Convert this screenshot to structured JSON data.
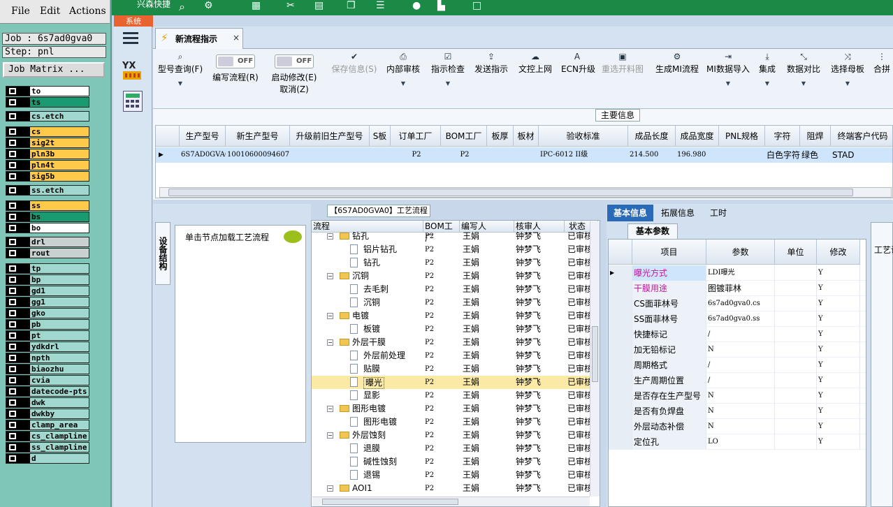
{
  "menu": {
    "file": "File",
    "edit": "Edit",
    "actions": "Actions"
  },
  "job": {
    "job_label": "Job : 6s7ad0gva0",
    "step_label": "Step: pnl",
    "matrix_button": "Job Matrix ..."
  },
  "layers": [
    {
      "name": "to",
      "color": "#ffffff"
    },
    {
      "name": "ts",
      "color": "#1a9a70"
    },
    {
      "name": "cs.etch",
      "color": "#a0d8cf"
    },
    {
      "name": "cs",
      "color": "#ffc94a"
    },
    {
      "name": "sig2t",
      "color": "#ffc94a"
    },
    {
      "name": "pln3b",
      "color": "#ffc94a"
    },
    {
      "name": "pln4t",
      "color": "#ffc94a"
    },
    {
      "name": "sig5b",
      "color": "#ffc94a"
    },
    {
      "name": "ss.etch",
      "color": "#a0d8cf"
    },
    {
      "name": "ss",
      "color": "#ffc94a"
    },
    {
      "name": "bs",
      "color": "#1a9a70"
    },
    {
      "name": "bo",
      "color": "#ffffff"
    },
    {
      "name": "drl",
      "color": "#c8d0d0"
    },
    {
      "name": "rout",
      "color": "#c8d0d0"
    },
    {
      "name": "tp",
      "color": "#a0d8cf"
    },
    {
      "name": "bp",
      "color": "#a0d8cf"
    },
    {
      "name": "gd1",
      "color": "#a0d8cf"
    },
    {
      "name": "gg1",
      "color": "#a0d8cf"
    },
    {
      "name": "gko",
      "color": "#a0d8cf"
    },
    {
      "name": "pb",
      "color": "#a0d8cf"
    },
    {
      "name": "pt",
      "color": "#a0d8cf"
    },
    {
      "name": "ydkdrl",
      "color": "#a0d8cf"
    },
    {
      "name": "npth",
      "color": "#a0d8cf"
    },
    {
      "name": "biaozhu",
      "color": "#a0d8cf"
    },
    {
      "name": "cvia",
      "color": "#a0d8cf"
    },
    {
      "name": "datecode-pts",
      "color": "#a0d8cf"
    },
    {
      "name": "dwk",
      "color": "#a0d8cf"
    },
    {
      "name": "dwkby",
      "color": "#a0d8cf"
    },
    {
      "name": "clamp_area",
      "color": "#a0d8cf"
    },
    {
      "name": "cs_clampline",
      "color": "#a0d8cf"
    },
    {
      "name": "ss_clampline",
      "color": "#a0d8cf"
    },
    {
      "name": "d",
      "color": "#a0d8cf"
    }
  ],
  "top": {
    "quick_label": "兴森快捷",
    "system_tab": "系统"
  },
  "tab": {
    "label": "新流程指示",
    "close": "×"
  },
  "toolbar": [
    {
      "label": "型号查询(F)",
      "icon": "search-icon",
      "glyph": "⌕",
      "disabled": false,
      "dropdown": true
    },
    {
      "label": "编写流程(R)",
      "icon": "toggle",
      "toggle": "OFF"
    },
    {
      "label": "启动修改(E)",
      "label2": "取消(Z)",
      "icon": "toggle",
      "toggle": "OFF"
    },
    {
      "label": "保存信息(S)",
      "icon": "check-icon",
      "glyph": "✔",
      "disabled": true
    },
    {
      "label": "内部审核",
      "icon": "print-icon",
      "glyph": "⎙",
      "disabled": false,
      "dropdown": true
    },
    {
      "label": "指示检查",
      "icon": "checkbox-icon",
      "glyph": "☑",
      "disabled": false,
      "dropdown": true
    },
    {
      "label": "发送指示",
      "icon": "upload-icon",
      "glyph": "⇪",
      "disabled": false
    },
    {
      "label": "文控上网",
      "icon": "cloud-upload-icon",
      "glyph": "☁",
      "disabled": false
    },
    {
      "label": "ECN升级",
      "icon": "font-icon",
      "glyph": "A",
      "disabled": false
    },
    {
      "label": "重选开料图",
      "icon": "image-icon",
      "glyph": "▣",
      "disabled": true
    },
    {
      "label": "生成MI流程",
      "icon": "gears-icon",
      "glyph": "⚙",
      "disabled": false
    },
    {
      "label": "MI数据导入",
      "icon": "import-icon",
      "glyph": "⇥",
      "disabled": false,
      "dropdown": true
    },
    {
      "label": "集成",
      "icon": "download-icon",
      "glyph": "⤓",
      "disabled": false,
      "dropdown": true
    },
    {
      "label": "数据对比",
      "icon": "compress-icon",
      "glyph": "⤡",
      "disabled": false,
      "dropdown": true
    },
    {
      "label": "选择母板",
      "icon": "shuffle-icon",
      "glyph": "⤨",
      "disabled": false,
      "dropdown": true
    },
    {
      "label": "合拼",
      "icon": "merge-icon",
      "glyph": "⋮",
      "disabled": false
    }
  ],
  "main_info": {
    "title": "主要信息",
    "columns": [
      "生产型号",
      "新生产型号",
      "升级前旧生产型号",
      "S板",
      "订单工厂",
      "BOM工厂",
      "板厚",
      "板材",
      "验收标准",
      "成品长度",
      "成品宽度",
      "PNL规格",
      "字符",
      "阻焊",
      "终端客户代码"
    ],
    "row": [
      "6S7AD0GVA0",
      "10010600094607",
      "",
      "",
      "P2",
      "P2",
      "",
      "",
      "IPC-6012 II级",
      "214.500",
      "196.980",
      "",
      "白色字符",
      "绿色",
      "STAD"
    ]
  },
  "flow": {
    "title": "【6S7AD0GVA0】工艺流程",
    "side_tab": "设备结构",
    "hint": "单击节点加载工艺流程",
    "columns": [
      "流程",
      "BOM工厂",
      "编写人",
      "核审人",
      "状态"
    ],
    "rows": [
      {
        "level": 1,
        "type": "folder",
        "name": "钻孔",
        "factory": "P2",
        "writer": "王娟",
        "reviewer": "钟梦飞",
        "status": "已审核"
      },
      {
        "level": 2,
        "type": "doc",
        "name": "铝片钻孔",
        "factory": "P2",
        "writer": "王娟",
        "reviewer": "钟梦飞",
        "status": "已审核"
      },
      {
        "level": 2,
        "type": "doc",
        "name": "钻孔",
        "factory": "P2",
        "writer": "王娟",
        "reviewer": "钟梦飞",
        "status": "已审核"
      },
      {
        "level": 1,
        "type": "folder",
        "name": "沉铜",
        "factory": "P2",
        "writer": "王娟",
        "reviewer": "钟梦飞",
        "status": "已审核"
      },
      {
        "level": 2,
        "type": "doc",
        "name": "去毛刺",
        "factory": "P2",
        "writer": "王娟",
        "reviewer": "钟梦飞",
        "status": "已审核"
      },
      {
        "level": 2,
        "type": "doc",
        "name": "沉铜",
        "factory": "P2",
        "writer": "王娟",
        "reviewer": "钟梦飞",
        "status": "已审核"
      },
      {
        "level": 1,
        "type": "folder",
        "name": "电镀",
        "factory": "P2",
        "writer": "王娟",
        "reviewer": "钟梦飞",
        "status": "已审核"
      },
      {
        "level": 2,
        "type": "doc",
        "name": "板镀",
        "factory": "P2",
        "writer": "王娟",
        "reviewer": "钟梦飞",
        "status": "已审核"
      },
      {
        "level": 1,
        "type": "folder",
        "name": "外层干膜",
        "factory": "P2",
        "writer": "王娟",
        "reviewer": "钟梦飞",
        "status": "已审核"
      },
      {
        "level": 2,
        "type": "doc",
        "name": "外层前处理",
        "factory": "P2",
        "writer": "王娟",
        "reviewer": "钟梦飞",
        "status": "已审核"
      },
      {
        "level": 2,
        "type": "doc",
        "name": "贴膜",
        "factory": "P2",
        "writer": "王娟",
        "reviewer": "钟梦飞",
        "status": "已审核"
      },
      {
        "level": 2,
        "type": "doc",
        "name": "曝光",
        "factory": "P2",
        "writer": "王娟",
        "reviewer": "钟梦飞",
        "status": "已审核",
        "selected": true
      },
      {
        "level": 2,
        "type": "doc",
        "name": "显影",
        "factory": "P2",
        "writer": "王娟",
        "reviewer": "钟梦飞",
        "status": "已审核"
      },
      {
        "level": 1,
        "type": "folder",
        "name": "图形电镀",
        "factory": "P2",
        "writer": "王娟",
        "reviewer": "钟梦飞",
        "status": "已审核"
      },
      {
        "level": 2,
        "type": "doc",
        "name": "图形电镀",
        "factory": "P2",
        "writer": "王娟",
        "reviewer": "钟梦飞",
        "status": "已审核"
      },
      {
        "level": 1,
        "type": "folder",
        "name": "外层蚀刻",
        "factory": "P2",
        "writer": "王娟",
        "reviewer": "钟梦飞",
        "status": "已审核"
      },
      {
        "level": 2,
        "type": "doc",
        "name": "退膜",
        "factory": "P2",
        "writer": "王娟",
        "reviewer": "钟梦飞",
        "status": "已审核"
      },
      {
        "level": 2,
        "type": "doc",
        "name": "碱性蚀刻",
        "factory": "P2",
        "writer": "王娟",
        "reviewer": "钟梦飞",
        "status": "已审核"
      },
      {
        "level": 2,
        "type": "doc",
        "name": "退锡",
        "factory": "P2",
        "writer": "王娟",
        "reviewer": "钟梦飞",
        "status": "已审核"
      },
      {
        "level": 1,
        "type": "folder",
        "name": "AOI1",
        "factory": "P2",
        "writer": "王娟",
        "reviewer": "钟梦飞",
        "status": "已审核"
      }
    ]
  },
  "right": {
    "tabs": [
      "基本信息",
      "拓展信息",
      "工时"
    ],
    "subtab": "基本参数",
    "far_label": "工艺说",
    "columns": [
      "项目",
      "参数",
      "单位",
      "修改"
    ],
    "rows": [
      {
        "item": "曝光方式",
        "param": "LDI曝光",
        "unit": "",
        "edit": "Y",
        "highlight": true
      },
      {
        "item": "干膜用途",
        "param": "图镀菲林",
        "unit": "",
        "edit": "Y",
        "highlight": true
      },
      {
        "item": "CS面菲林号",
        "param": "6s7ad0gva0.cs",
        "unit": "",
        "edit": "Y"
      },
      {
        "item": "SS面菲林号",
        "param": "6s7ad0gva0.ss",
        "unit": "",
        "edit": "Y"
      },
      {
        "item": "快捷标记",
        "param": "/",
        "unit": "",
        "edit": "Y"
      },
      {
        "item": "加无铅标记",
        "param": "N",
        "unit": "",
        "edit": "Y"
      },
      {
        "item": "周期格式",
        "param": "/",
        "unit": "",
        "edit": "Y"
      },
      {
        "item": "生产周期位置",
        "param": "/",
        "unit": "",
        "edit": "Y"
      },
      {
        "item": "是否存在生产型号",
        "param": "N",
        "unit": "",
        "edit": "Y"
      },
      {
        "item": "是否有负焊盘",
        "param": "N",
        "unit": "",
        "edit": "Y"
      },
      {
        "item": "外层动态补偿",
        "param": "N",
        "unit": "",
        "edit": "Y"
      },
      {
        "item": "定位孔",
        "param": "LO",
        "unit": "",
        "edit": "Y"
      }
    ]
  },
  "colors": {
    "accent": "#2a6ab8",
    "highlight_text": "#c0189a",
    "selected_row": "#fbe9a6"
  }
}
